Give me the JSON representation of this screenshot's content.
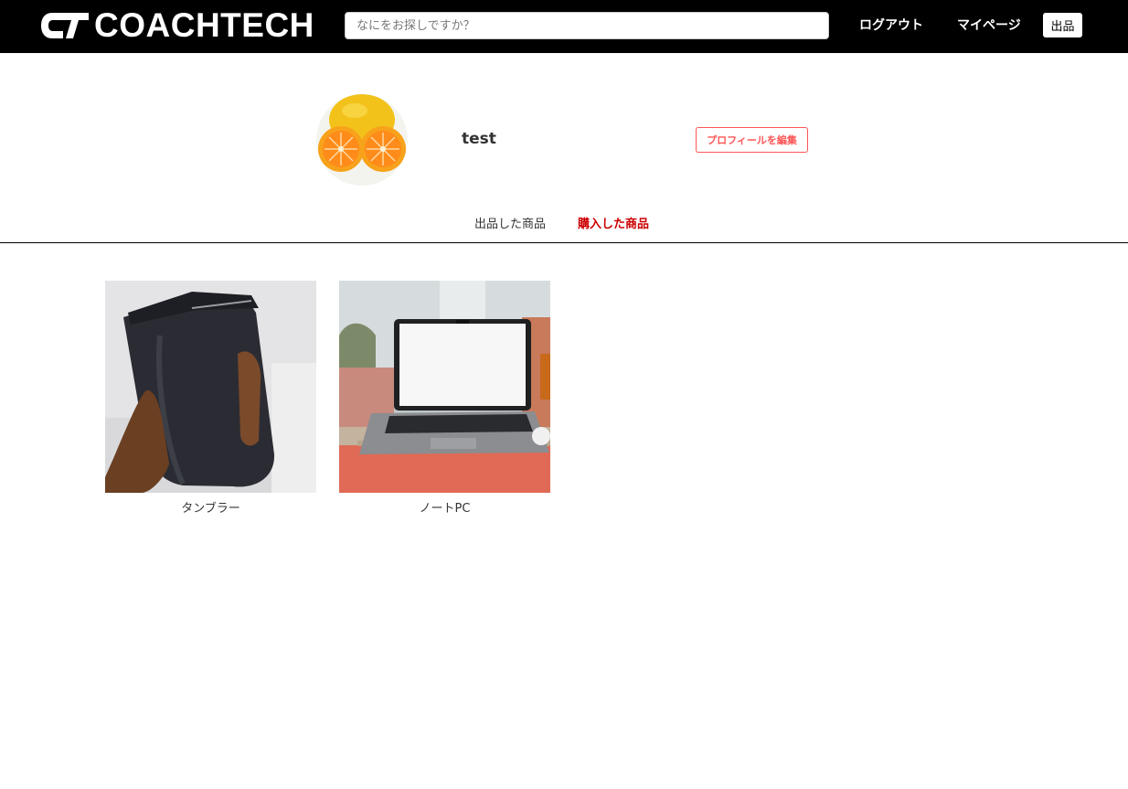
{
  "header": {
    "logo_text": "COACHTECH",
    "search": {
      "placeholder": "なにをお探しですか？",
      "value": ""
    },
    "nav": {
      "logout_label": "ログアウト",
      "mypage_label": "マイページ",
      "sell_label": "出品"
    }
  },
  "profile": {
    "username": "test",
    "edit_button_label": "プロフィールを編集",
    "avatar_icon": "orange-photo"
  },
  "tabs": [
    {
      "label": "出品した商品",
      "active": false
    },
    {
      "label": "購入した商品",
      "active": true
    }
  ],
  "items": [
    {
      "name": "タンブラー",
      "image": "tumbler-photo"
    },
    {
      "name": "ノートPC",
      "image": "laptop-photo"
    }
  ],
  "colors": {
    "header_bg": "#000000",
    "accent_red": "#ff5555",
    "active_tab": "#cc0000"
  }
}
